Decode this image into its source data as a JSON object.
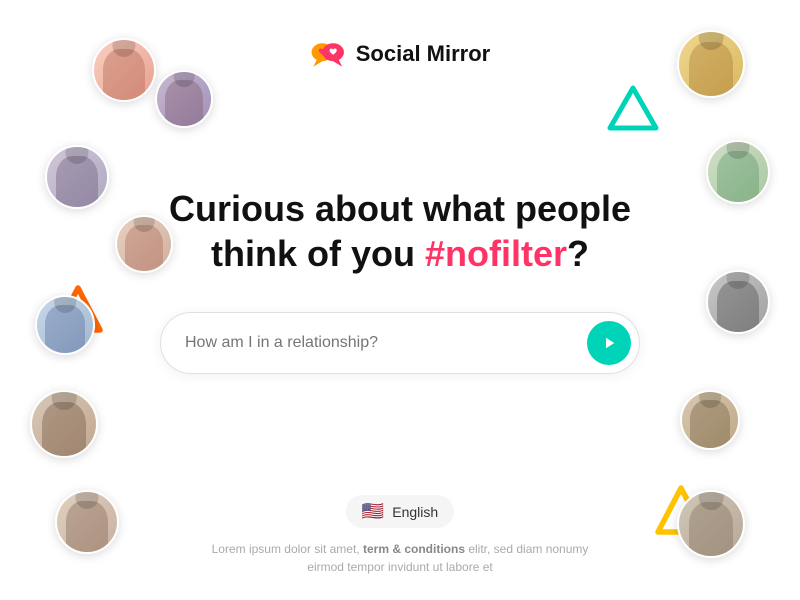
{
  "app": {
    "name": "Social Mirror",
    "logo_alt": "Social Mirror logo"
  },
  "header": {
    "logo_text": "Social Mirror"
  },
  "main": {
    "headline_part1": "Curious about what people",
    "headline_part2": "think of you ",
    "headline_highlight": "#nofilter",
    "headline_end": "?",
    "input_placeholder": "How am I in a relationship?",
    "submit_button_label": "Go"
  },
  "language": {
    "label": "English",
    "flag": "🇺🇸"
  },
  "footer": {
    "text_normal1": "Lorem ipsum dolor sit amet, ",
    "text_bold": "term & conditions",
    "text_normal2": " elitr, sed diam nonumy eirmod tempor invidunt ut labore et"
  },
  "decorations": {
    "triangle_colors": [
      "#ffc300",
      "#00d4b8",
      "#ff6b00",
      "#ffc300"
    ],
    "accent_color": "#00d4b8",
    "highlight_color": "#ff3366"
  }
}
